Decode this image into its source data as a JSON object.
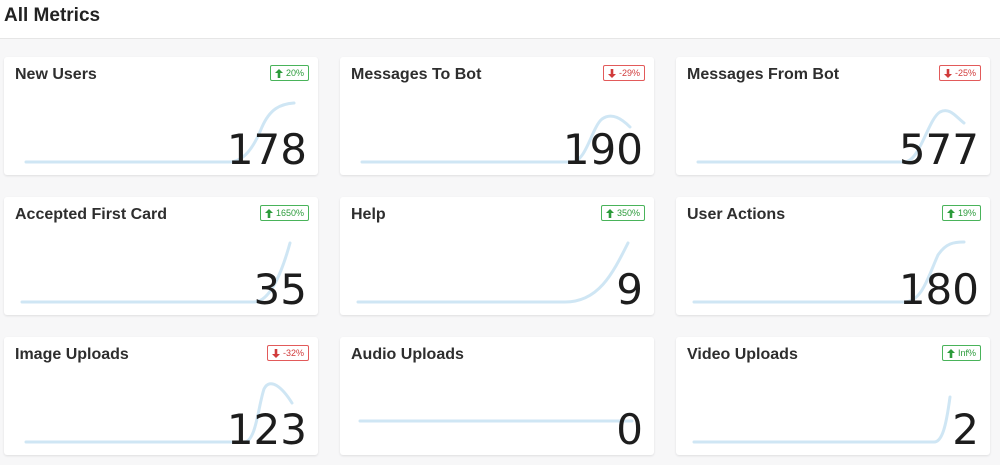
{
  "header": {
    "title": "All Metrics"
  },
  "colors": {
    "up": "#2c9b3b",
    "down": "#d13b3b",
    "sparkline": "#cfe6f4"
  },
  "metrics": [
    {
      "title": "New Users",
      "value": "178",
      "change": "20%",
      "direction": "up",
      "trend_icon": "arrow-up-icon"
    },
    {
      "title": "Messages To Bot",
      "value": "190",
      "change": "-29%",
      "direction": "down",
      "trend_icon": "arrow-down-icon"
    },
    {
      "title": "Messages From Bot",
      "value": "577",
      "change": "-25%",
      "direction": "down",
      "trend_icon": "arrow-down-icon"
    },
    {
      "title": "Accepted First Card",
      "value": "35",
      "change": "1650%",
      "direction": "up",
      "trend_icon": "arrow-up-icon"
    },
    {
      "title": "Help",
      "value": "9",
      "change": "350%",
      "direction": "up",
      "trend_icon": "arrow-up-icon"
    },
    {
      "title": "User Actions",
      "value": "180",
      "change": "19%",
      "direction": "up",
      "trend_icon": "arrow-up-icon"
    },
    {
      "title": "Image Uploads",
      "value": "123",
      "change": "-32%",
      "direction": "down",
      "trend_icon": "arrow-down-icon"
    },
    {
      "title": "Audio Uploads",
      "value": "0",
      "change": null,
      "direction": null,
      "trend_icon": null
    },
    {
      "title": "Video Uploads",
      "value": "2",
      "change": "Inf%",
      "direction": "up",
      "trend_icon": "arrow-up-icon"
    }
  ]
}
